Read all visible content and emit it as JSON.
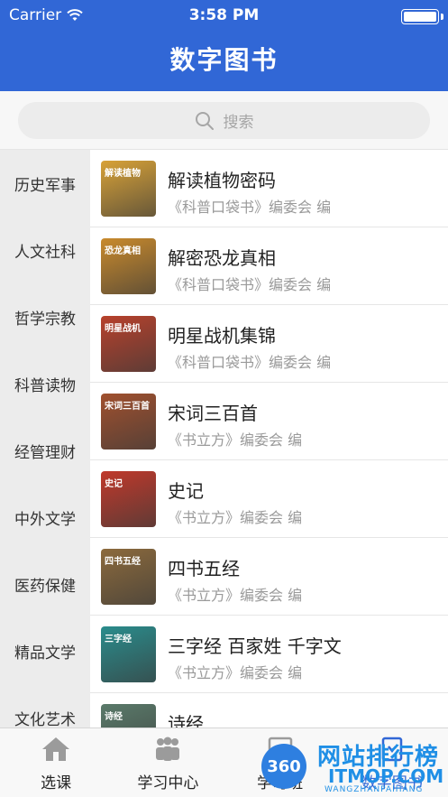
{
  "status_bar": {
    "carrier": "Carrier",
    "time": "3:58 PM"
  },
  "header": {
    "title": "数字图书"
  },
  "search": {
    "placeholder": "搜索"
  },
  "sidebar": {
    "categories": [
      "历史军事",
      "人文社科",
      "哲学宗教",
      "科普读物",
      "经管理财",
      "中外文学",
      "医药保健",
      "精品文学",
      "文化艺术"
    ]
  },
  "books": [
    {
      "title": "解读植物密码",
      "author": "《科普口袋书》编委会 编",
      "cover_text": "解读植物",
      "cover_color": "#d8a238"
    },
    {
      "title": "解密恐龙真相",
      "author": "《科普口袋书》编委会 编",
      "cover_text": "恐龙真相",
      "cover_color": "#c98a2c"
    },
    {
      "title": "明星战机集锦",
      "author": "《科普口袋书》编委会 编",
      "cover_text": "明星战机",
      "cover_color": "#b8412c"
    },
    {
      "title": "宋词三百首",
      "author": "《书立方》编委会 编",
      "cover_text": "宋词三百首",
      "cover_color": "#a0502e"
    },
    {
      "title": "史记",
      "author": "《书立方》编委会 编",
      "cover_text": "史记",
      "cover_color": "#c0392b"
    },
    {
      "title": "四书五经",
      "author": "《书立方》编委会 编",
      "cover_text": "四书五经",
      "cover_color": "#8c6a3c"
    },
    {
      "title": "三字经 百家姓 千字文",
      "author": "《书立方》编委会 编",
      "cover_text": "三字经",
      "cover_color": "#2a8c8c"
    },
    {
      "title": "诗经",
      "author": "",
      "cover_text": "诗经",
      "cover_color": "#5a7a6a"
    }
  ],
  "tabbar": {
    "tabs": [
      {
        "label": "选课",
        "icon": "home-icon"
      },
      {
        "label": "学习中心",
        "icon": "people-icon"
      },
      {
        "label": "学习班",
        "icon": "class-icon"
      },
      {
        "label": "数字图书",
        "icon": "book-icon"
      }
    ]
  },
  "watermark": {
    "badge": "360",
    "cn": "网站排行榜",
    "en": "ITMOP.COM",
    "sub": "WANGZHANPAIHANG"
  },
  "colors": {
    "accent": "#3167d6",
    "sidebar_bg": "#ececec"
  }
}
